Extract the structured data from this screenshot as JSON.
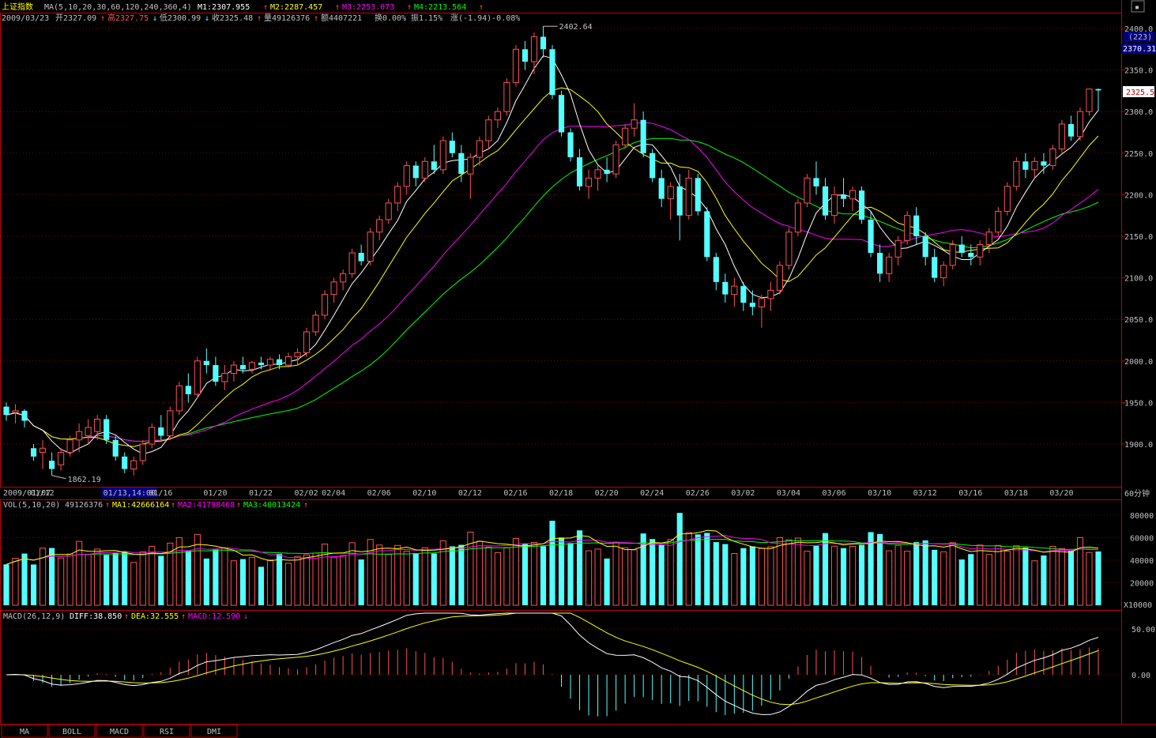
{
  "header": {
    "index_name": "上证指数",
    "ma_params": "MA(5,10,20,30,60,120,240,360,4)",
    "m1": "M1:2307.955",
    "m2": "M2:2287.457",
    "m3": "M3:2253.073",
    "m4": "M4:2213.564",
    "date": "2009/03/23",
    "open": "开2327.09",
    "high": "高2327.75",
    "low": "低2300.99",
    "close": "收2325.48",
    "volume": "量49126376",
    "amount": "额4407221",
    "turnover": "换0.00%",
    "amplitude": "振1.15%",
    "change": "涨(-1.94)-0.08%",
    "up_arrow": "↑",
    "down_arrow": "↓"
  },
  "price_axis": {
    "ticks": [
      "2400.0",
      "2350.0",
      "2300.0",
      "2250.0",
      "2200.0",
      "2150.0",
      "2100.0",
      "2050.0",
      "2000.0",
      "1950.0",
      "1900.0"
    ],
    "count_badge": "(223)",
    "crosshair_value": "2370.31",
    "last_price": "2325.5"
  },
  "date_axis": {
    "labels": [
      "2009/01/07",
      "01/12",
      "01/13,14:00",
      "01/16",
      "01/20",
      "01/22",
      "02/02",
      "02/04",
      "02/06",
      "02/10",
      "02/12",
      "02/16",
      "02/18",
      "02/20",
      "02/24",
      "02/26",
      "03/02",
      "03/04",
      "03/06",
      "03/10",
      "03/12",
      "03/16",
      "03/18",
      "03/20"
    ],
    "period": "60分钟"
  },
  "annotations": {
    "high_label": "2402.64",
    "low_label": "1862.19"
  },
  "vol": {
    "params": "VOL(5,10,20)",
    "value": "49126376",
    "ma1": "MA1:42666164",
    "ma2": "MA2:41798468",
    "ma3": "MA3:40013424",
    "ticks": [
      "80000",
      "60000",
      "40000",
      "20000"
    ],
    "unit": "X10000"
  },
  "macd": {
    "params": "MACD(26,12,9)",
    "diff": "DIFF:38.850",
    "dea": "DEA:32.555",
    "macd": "MACD:12.590",
    "ticks": [
      "50.00",
      "0.00"
    ]
  },
  "tabs": [
    "MA",
    "BOLL",
    "MACD",
    "RSI",
    "DMI"
  ],
  "colors": {
    "up": "#ff5050",
    "down": "#54ffff",
    "ma5": "#ffffff",
    "ma10": "#ffff00",
    "ma20": "#ff00ff",
    "ma30": "#00ff00",
    "frame": "#c00000",
    "grid": "#800000",
    "yellow": "#ffff00"
  },
  "chart_data": {
    "type": "candlestick",
    "title": "上证指数",
    "period": "60分钟",
    "ylim": [
      1862.19,
      2402.64
    ],
    "events": [
      {
        "label": "high",
        "value": 2402.64
      },
      {
        "label": "low",
        "value": 1862.19
      }
    ],
    "candles": [
      {
        "seg": 0,
        "o": 1945,
        "h": 1950,
        "l": 1928,
        "c": 1935
      },
      {
        "seg": 0,
        "o": 1938,
        "h": 1948,
        "l": 1925,
        "c": 1940
      },
      {
        "seg": 0,
        "o": 1940,
        "h": 1942,
        "l": 1920,
        "c": 1928
      },
      {
        "seg": 1,
        "o": 1895,
        "h": 1900,
        "l": 1880,
        "c": 1885
      },
      {
        "seg": 1,
        "o": 1890,
        "h": 1905,
        "l": 1870,
        "c": 1895
      },
      {
        "seg": 1,
        "o": 1880,
        "h": 1890,
        "l": 1862.19,
        "c": 1870
      },
      {
        "seg": 1,
        "o": 1875,
        "h": 1895,
        "l": 1868,
        "c": 1890
      },
      {
        "seg": 1,
        "o": 1890,
        "h": 1910,
        "l": 1885,
        "c": 1905
      },
      {
        "seg": 1,
        "o": 1905,
        "h": 1925,
        "l": 1890,
        "c": 1915
      },
      {
        "seg": 1,
        "o": 1910,
        "h": 1930,
        "l": 1900,
        "c": 1920
      },
      {
        "seg": 1,
        "o": 1915,
        "h": 1935,
        "l": 1905,
        "c": 1930
      },
      {
        "seg": 2,
        "o": 1930,
        "h": 1935,
        "l": 1900,
        "c": 1905
      },
      {
        "seg": 2,
        "o": 1905,
        "h": 1910,
        "l": 1880,
        "c": 1885
      },
      {
        "seg": 2,
        "o": 1885,
        "h": 1890,
        "l": 1865,
        "c": 1870
      },
      {
        "seg": 2,
        "o": 1870,
        "h": 1885,
        "l": 1862.19,
        "c": 1880
      },
      {
        "seg": 2,
        "o": 1880,
        "h": 1905,
        "l": 1875,
        "c": 1900
      },
      {
        "seg": 3,
        "o": 1900,
        "h": 1925,
        "l": 1895,
        "c": 1920
      },
      {
        "seg": 3,
        "o": 1920,
        "h": 1935,
        "l": 1905,
        "c": 1910
      },
      {
        "seg": 3,
        "o": 1910,
        "h": 1945,
        "l": 1905,
        "c": 1940
      },
      {
        "seg": 3,
        "o": 1940,
        "h": 1975,
        "l": 1935,
        "c": 1970
      },
      {
        "seg": 3,
        "o": 1970,
        "h": 1985,
        "l": 1950,
        "c": 1960
      },
      {
        "seg": 3,
        "o": 1960,
        "h": 2005,
        "l": 1955,
        "c": 2000
      },
      {
        "seg": 4,
        "o": 2000,
        "h": 2015,
        "l": 1985,
        "c": 1995
      },
      {
        "seg": 4,
        "o": 1995,
        "h": 2005,
        "l": 1970,
        "c": 1975
      },
      {
        "seg": 4,
        "o": 1975,
        "h": 1995,
        "l": 1965,
        "c": 1985
      },
      {
        "seg": 4,
        "o": 1985,
        "h": 2000,
        "l": 1975,
        "c": 1995
      },
      {
        "seg": 4,
        "o": 1995,
        "h": 2005,
        "l": 1985,
        "c": 1990
      },
      {
        "seg": 5,
        "o": 1990,
        "h": 2000,
        "l": 1985,
        "c": 1998
      },
      {
        "seg": 5,
        "o": 1998,
        "h": 2005,
        "l": 1990,
        "c": 1995
      },
      {
        "seg": 5,
        "o": 1995,
        "h": 2005,
        "l": 1988,
        "c": 2002
      },
      {
        "seg": 5,
        "o": 2002,
        "h": 2008,
        "l": 1990,
        "c": 1995
      },
      {
        "seg": 5,
        "o": 1995,
        "h": 2010,
        "l": 1992,
        "c": 2005
      },
      {
        "seg": 6,
        "o": 2005,
        "h": 2015,
        "l": 1995,
        "c": 2010
      },
      {
        "seg": 6,
        "o": 2010,
        "h": 2040,
        "l": 2005,
        "c": 2035
      },
      {
        "seg": 6,
        "o": 2035,
        "h": 2060,
        "l": 2030,
        "c": 2055
      },
      {
        "seg": 7,
        "o": 2055,
        "h": 2085,
        "l": 2050,
        "c": 2080
      },
      {
        "seg": 7,
        "o": 2080,
        "h": 2100,
        "l": 2070,
        "c": 2095
      },
      {
        "seg": 7,
        "o": 2095,
        "h": 2110,
        "l": 2085,
        "c": 2105
      },
      {
        "seg": 7,
        "o": 2105,
        "h": 2135,
        "l": 2100,
        "c": 2130
      },
      {
        "seg": 7,
        "o": 2130,
        "h": 2140,
        "l": 2115,
        "c": 2120
      },
      {
        "seg": 8,
        "o": 2120,
        "h": 2160,
        "l": 2115,
        "c": 2155
      },
      {
        "seg": 8,
        "o": 2155,
        "h": 2175,
        "l": 2145,
        "c": 2170
      },
      {
        "seg": 8,
        "o": 2170,
        "h": 2195,
        "l": 2165,
        "c": 2190
      },
      {
        "seg": 8,
        "o": 2190,
        "h": 2215,
        "l": 2180,
        "c": 2210
      },
      {
        "seg": 8,
        "o": 2210,
        "h": 2240,
        "l": 2200,
        "c": 2235
      },
      {
        "seg": 9,
        "o": 2235,
        "h": 2240,
        "l": 2210,
        "c": 2220
      },
      {
        "seg": 9,
        "o": 2220,
        "h": 2245,
        "l": 2215,
        "c": 2240
      },
      {
        "seg": 9,
        "o": 2240,
        "h": 2260,
        "l": 2225,
        "c": 2230
      },
      {
        "seg": 9,
        "o": 2230,
        "h": 2270,
        "l": 2225,
        "c": 2265
      },
      {
        "seg": 9,
        "o": 2265,
        "h": 2275,
        "l": 2245,
        "c": 2250
      },
      {
        "seg": 10,
        "o": 2250,
        "h": 2260,
        "l": 2215,
        "c": 2225
      },
      {
        "seg": 10,
        "o": 2225,
        "h": 2250,
        "l": 2195,
        "c": 2245
      },
      {
        "seg": 10,
        "o": 2245,
        "h": 2270,
        "l": 2235,
        "c": 2265
      },
      {
        "seg": 10,
        "o": 2265,
        "h": 2295,
        "l": 2255,
        "c": 2290
      },
      {
        "seg": 10,
        "o": 2290,
        "h": 2305,
        "l": 2280,
        "c": 2300
      },
      {
        "seg": 11,
        "o": 2300,
        "h": 2340,
        "l": 2295,
        "c": 2335
      },
      {
        "seg": 11,
        "o": 2335,
        "h": 2380,
        "l": 2330,
        "c": 2375
      },
      {
        "seg": 11,
        "o": 2375,
        "h": 2385,
        "l": 2350,
        "c": 2360
      },
      {
        "seg": 11,
        "o": 2360,
        "h": 2395,
        "l": 2345,
        "c": 2390
      },
      {
        "seg": 11,
        "o": 2390,
        "h": 2402.64,
        "l": 2365,
        "c": 2375
      },
      {
        "seg": 12,
        "o": 2375,
        "h": 2380,
        "l": 2315,
        "c": 2320
      },
      {
        "seg": 12,
        "o": 2320,
        "h": 2325,
        "l": 2270,
        "c": 2275
      },
      {
        "seg": 12,
        "o": 2275,
        "h": 2280,
        "l": 2240,
        "c": 2245
      },
      {
        "seg": 12,
        "o": 2245,
        "h": 2255,
        "l": 2205,
        "c": 2210
      },
      {
        "seg": 12,
        "o": 2210,
        "h": 2230,
        "l": 2195,
        "c": 2220
      },
      {
        "seg": 13,
        "o": 2220,
        "h": 2235,
        "l": 2205,
        "c": 2230
      },
      {
        "seg": 13,
        "o": 2230,
        "h": 2245,
        "l": 2215,
        "c": 2225
      },
      {
        "seg": 13,
        "o": 2225,
        "h": 2265,
        "l": 2220,
        "c": 2260
      },
      {
        "seg": 13,
        "o": 2260,
        "h": 2285,
        "l": 2255,
        "c": 2280
      },
      {
        "seg": 13,
        "o": 2280,
        "h": 2310,
        "l": 2270,
        "c": 2290
      },
      {
        "seg": 14,
        "o": 2290,
        "h": 2300,
        "l": 2245,
        "c": 2250
      },
      {
        "seg": 14,
        "o": 2250,
        "h": 2255,
        "l": 2215,
        "c": 2220
      },
      {
        "seg": 14,
        "o": 2220,
        "h": 2230,
        "l": 2185,
        "c": 2195
      },
      {
        "seg": 14,
        "o": 2195,
        "h": 2215,
        "l": 2170,
        "c": 2210
      },
      {
        "seg": 14,
        "o": 2210,
        "h": 2225,
        "l": 2145,
        "c": 2175
      },
      {
        "seg": 15,
        "o": 2175,
        "h": 2230,
        "l": 2170,
        "c": 2220
      },
      {
        "seg": 15,
        "o": 2220,
        "h": 2225,
        "l": 2175,
        "c": 2180
      },
      {
        "seg": 15,
        "o": 2180,
        "h": 2185,
        "l": 2120,
        "c": 2125
      },
      {
        "seg": 15,
        "o": 2125,
        "h": 2130,
        "l": 2085,
        "c": 2095
      },
      {
        "seg": 15,
        "o": 2095,
        "h": 2105,
        "l": 2070,
        "c": 2080
      },
      {
        "seg": 16,
        "o": 2080,
        "h": 2100,
        "l": 2065,
        "c": 2090
      },
      {
        "seg": 16,
        "o": 2090,
        "h": 2095,
        "l": 2060,
        "c": 2070
      },
      {
        "seg": 16,
        "o": 2070,
        "h": 2085,
        "l": 2055,
        "c": 2065
      },
      {
        "seg": 16,
        "o": 2065,
        "h": 2080,
        "l": 2040,
        "c": 2075
      },
      {
        "seg": 16,
        "o": 2075,
        "h": 2095,
        "l": 2060,
        "c": 2085
      },
      {
        "seg": 17,
        "o": 2085,
        "h": 2120,
        "l": 2080,
        "c": 2115
      },
      {
        "seg": 17,
        "o": 2115,
        "h": 2160,
        "l": 2110,
        "c": 2155
      },
      {
        "seg": 17,
        "o": 2155,
        "h": 2195,
        "l": 2150,
        "c": 2190
      },
      {
        "seg": 17,
        "o": 2190,
        "h": 2225,
        "l": 2185,
        "c": 2220
      },
      {
        "seg": 17,
        "o": 2220,
        "h": 2240,
        "l": 2200,
        "c": 2210
      },
      {
        "seg": 18,
        "o": 2210,
        "h": 2220,
        "l": 2170,
        "c": 2175
      },
      {
        "seg": 18,
        "o": 2175,
        "h": 2210,
        "l": 2165,
        "c": 2200
      },
      {
        "seg": 18,
        "o": 2200,
        "h": 2220,
        "l": 2185,
        "c": 2195
      },
      {
        "seg": 18,
        "o": 2195,
        "h": 2210,
        "l": 2180,
        "c": 2205
      },
      {
        "seg": 18,
        "o": 2205,
        "h": 2210,
        "l": 2165,
        "c": 2170
      },
      {
        "seg": 19,
        "o": 2170,
        "h": 2180,
        "l": 2125,
        "c": 2130
      },
      {
        "seg": 19,
        "o": 2130,
        "h": 2140,
        "l": 2095,
        "c": 2105
      },
      {
        "seg": 19,
        "o": 2105,
        "h": 2130,
        "l": 2095,
        "c": 2125
      },
      {
        "seg": 19,
        "o": 2125,
        "h": 2150,
        "l": 2115,
        "c": 2145
      },
      {
        "seg": 19,
        "o": 2145,
        "h": 2180,
        "l": 2140,
        "c": 2175
      },
      {
        "seg": 20,
        "o": 2175,
        "h": 2185,
        "l": 2140,
        "c": 2150
      },
      {
        "seg": 20,
        "o": 2150,
        "h": 2155,
        "l": 2115,
        "c": 2125
      },
      {
        "seg": 20,
        "o": 2125,
        "h": 2135,
        "l": 2095,
        "c": 2100
      },
      {
        "seg": 20,
        "o": 2100,
        "h": 2120,
        "l": 2090,
        "c": 2115
      },
      {
        "seg": 20,
        "o": 2115,
        "h": 2145,
        "l": 2110,
        "c": 2140
      },
      {
        "seg": 21,
        "o": 2140,
        "h": 2150,
        "l": 2125,
        "c": 2130
      },
      {
        "seg": 21,
        "o": 2130,
        "h": 2140,
        "l": 2115,
        "c": 2125
      },
      {
        "seg": 21,
        "o": 2125,
        "h": 2145,
        "l": 2115,
        "c": 2140
      },
      {
        "seg": 21,
        "o": 2140,
        "h": 2160,
        "l": 2130,
        "c": 2155
      },
      {
        "seg": 21,
        "o": 2155,
        "h": 2185,
        "l": 2150,
        "c": 2180
      },
      {
        "seg": 22,
        "o": 2180,
        "h": 2215,
        "l": 2175,
        "c": 2210
      },
      {
        "seg": 22,
        "o": 2210,
        "h": 2245,
        "l": 2205,
        "c": 2240
      },
      {
        "seg": 22,
        "o": 2240,
        "h": 2250,
        "l": 2220,
        "c": 2230
      },
      {
        "seg": 22,
        "o": 2230,
        "h": 2245,
        "l": 2220,
        "c": 2240
      },
      {
        "seg": 22,
        "o": 2240,
        "h": 2250,
        "l": 2225,
        "c": 2235
      },
      {
        "seg": 23,
        "o": 2235,
        "h": 2260,
        "l": 2230,
        "c": 2255
      },
      {
        "seg": 23,
        "o": 2255,
        "h": 2290,
        "l": 2250,
        "c": 2285
      },
      {
        "seg": 23,
        "o": 2285,
        "h": 2295,
        "l": 2265,
        "c": 2270
      },
      {
        "seg": 23,
        "o": 2270,
        "h": 2305,
        "l": 2265,
        "c": 2300
      },
      {
        "seg": 23,
        "o": 2300,
        "h": 2327.75,
        "l": 2295,
        "c": 2327.09
      },
      {
        "seg": 23,
        "o": 2327.09,
        "h": 2327.75,
        "l": 2300.99,
        "c": 2325.48
      }
    ]
  }
}
